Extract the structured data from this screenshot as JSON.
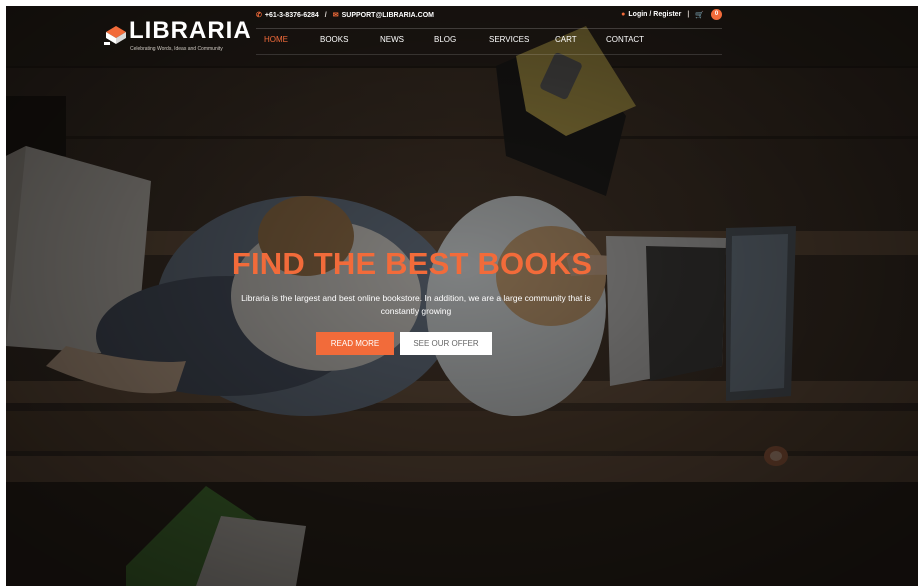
{
  "brand": {
    "name": "LIBRARIA",
    "tagline": "Celebrating Words, Ideas and Community"
  },
  "topbar": {
    "phone": "+61-3-8376-6284",
    "separator": "/",
    "email": "SUPPORT@LIBRARIA.COM",
    "account_label": "Login / Register",
    "divider": "|",
    "cart_count": "0"
  },
  "nav": {
    "items": [
      {
        "label": "HOME",
        "active": true
      },
      {
        "label": "BOOKS",
        "active": false
      },
      {
        "label": "NEWS",
        "active": false
      },
      {
        "label": "BLOG",
        "active": false
      },
      {
        "label": "SERVICES",
        "active": false
      },
      {
        "label": "CART",
        "active": false
      },
      {
        "label": "CONTACT",
        "active": false
      }
    ]
  },
  "hero": {
    "title": "FIND THE BEST BOOKS",
    "subtitle": "Libraria is the largest and best online bookstore. In addition, we are a large community that is constantly growing",
    "primary_button": "READ MORE",
    "secondary_button": "SEE OUR OFFER"
  },
  "colors": {
    "accent": "#f26b3a",
    "text_light": "#ffffff",
    "overlay": "#0a0806"
  },
  "icons": {
    "phone": "phone-icon",
    "email": "envelope-icon",
    "account": "lock-icon",
    "cart": "cart-icon",
    "logo": "book-logo-icon"
  }
}
